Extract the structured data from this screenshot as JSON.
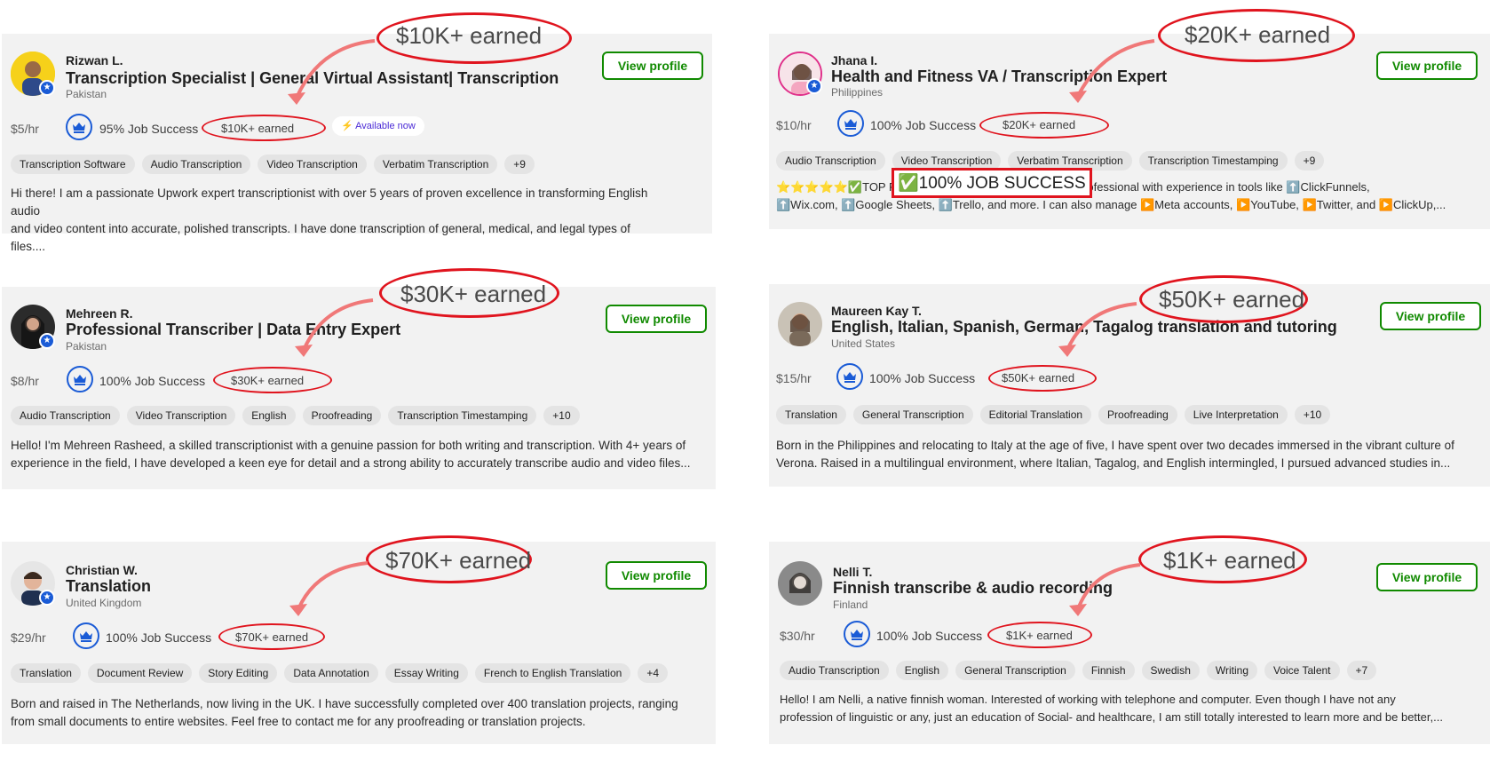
{
  "cards": [
    {
      "name": "Rizwan L.",
      "title": "Transcription Specialist | General Virtual Assistant| Transcription",
      "country": "Pakistan",
      "view_label": "View profile",
      "rate": "$5/hr",
      "job_success": "95% Job Success",
      "earned": "$10K+ earned",
      "available": "Available now",
      "skills": [
        "Transcription Software",
        "Audio Transcription",
        "Video Transcription",
        "Verbatim Transcription",
        "+9"
      ],
      "desc_line1": "Hi there! I am a passionate Upwork expert transcriptionist with over 5 years of proven excellence in transforming English audio",
      "desc_line2": "and video content into accurate, polished transcripts. I have done transcription of general, medical, and legal types of files....",
      "callout": "$10K+ earned"
    },
    {
      "name": "Jhana I.",
      "title": "Health and Fitness VA / Transcription Expert",
      "country": "Philippines",
      "view_label": "View profile",
      "rate": "$10/hr",
      "job_success": "100% Job Success",
      "earned": "$20K+ earned",
      "skills": [
        "Audio Transcription",
        "Video Transcription",
        "Verbatim Transcription",
        "Transcription Timestamping",
        "+9"
      ],
      "desc_line1": "⭐⭐⭐⭐⭐✅TOP RA",
      "desc_line1_rest": "tech-savvy professional with experience in tools like ⬆️ClickFunnels,",
      "desc_line2": "⬆️Wix.com, ⬆️Google Sheets, ⬆️Trello, and more. I can also manage ▶️Meta accounts, ▶️YouTube, ▶️Twitter, and ▶️ClickUp,...",
      "callout": "$20K+ earned",
      "highlight": "✅100% JOB SUCCESS"
    },
    {
      "name": "Mehreen R.",
      "title": "Professional Transcriber | Data Entry Expert",
      "country": "Pakistan",
      "view_label": "View profile",
      "rate": "$8/hr",
      "job_success": "100% Job Success",
      "earned": "$30K+ earned",
      "skills": [
        "Audio Transcription",
        "Video Transcription",
        "English",
        "Proofreading",
        "Transcription Timestamping",
        "+10"
      ],
      "desc_line1": "Hello! I'm Mehreen Rasheed, a skilled transcriptionist with a genuine passion for both writing and transcription. With 4+ years of",
      "desc_line2": "experience in the field, I have developed a keen eye for detail and a strong ability to accurately transcribe audio and video files...",
      "callout": "$30K+ earned"
    },
    {
      "name": "Maureen Kay T.",
      "title": "English, Italian, Spanish, German, Tagalog translation and tutoring",
      "country": "United States",
      "view_label": "View profile",
      "rate": "$15/hr",
      "job_success": "100% Job Success",
      "earned": "$50K+ earned",
      "skills": [
        "Translation",
        "General Transcription",
        "Editorial Translation",
        "Proofreading",
        "Live Interpretation",
        "+10"
      ],
      "desc_line1": "Born in the Philippines and relocating to Italy at the age of five, I have spent over two decades immersed in the vibrant culture of",
      "desc_line2": "Verona. Raised in a multilingual environment, where Italian, Tagalog, and English intermingled, I pursued advanced studies in...",
      "callout": "$50K+ earned"
    },
    {
      "name": "Christian W.",
      "title": "Translation",
      "country": "United Kingdom",
      "view_label": "View profile",
      "rate": "$29/hr",
      "job_success": "100% Job Success",
      "earned": "$70K+ earned",
      "skills": [
        "Translation",
        "Document Review",
        "Story Editing",
        "Data Annotation",
        "Essay Writing",
        "French to English Translation",
        "+4"
      ],
      "desc_line1": "Born and raised in The Netherlands, now living in the UK. I have successfully completed over 400 translation projects, ranging",
      "desc_line2": "from small documents to entire websites. Feel free to contact me for any proofreading or translation projects.",
      "callout": "$70K+ earned"
    },
    {
      "name": "Nelli T.",
      "title": "Finnish transcribe & audio recording",
      "country": "Finland",
      "view_label": "View profile",
      "rate": "$30/hr",
      "job_success": "100% Job Success",
      "earned": "$1K+ earned",
      "skills": [
        "Audio Transcription",
        "English",
        "General Transcription",
        "Finnish",
        "Swedish",
        "Writing",
        "Voice Talent",
        "+7"
      ],
      "desc_line1": "Hello! I am Nelli, a native finnish woman. Interested of working with telephone and computer. Even though I have not any",
      "desc_line2": "profession of linguistic or any, just an education of Social- and healthcare, I am still totally interested to learn more and be better,...",
      "callout": "$1K+ earned"
    }
  ],
  "icons": {
    "badge": "star-badge-icon",
    "job_success": "crown-icon",
    "available": "lightning-icon",
    "arrow": "curved-arrow-icon"
  },
  "colors": {
    "accent_green": "#108a00",
    "annotation_red": "#e0141e",
    "job_success_blue": "#1a5bd6",
    "card_bg": "#f2f2f2"
  }
}
